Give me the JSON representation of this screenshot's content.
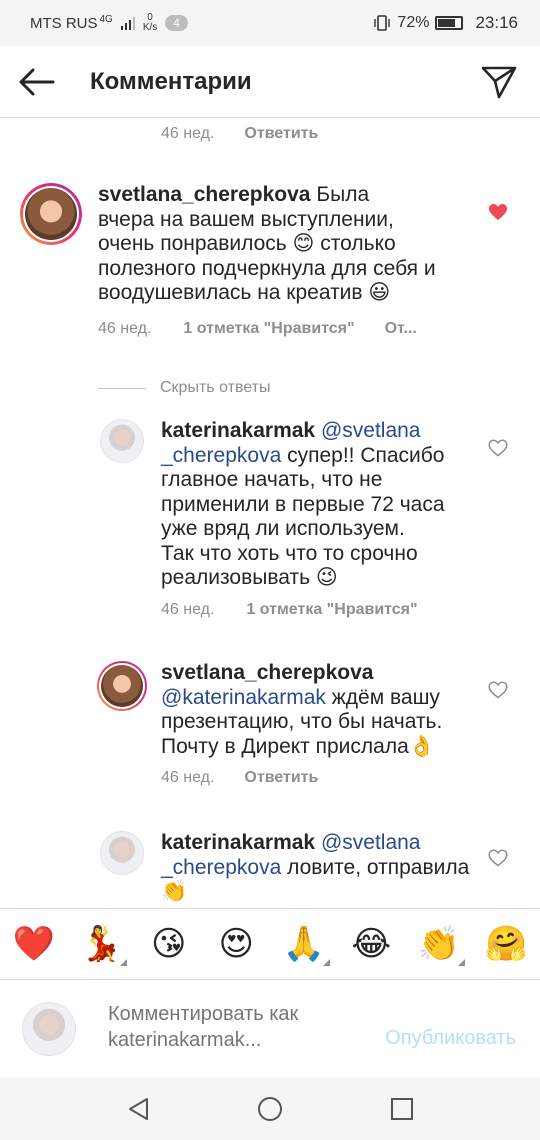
{
  "status_bar": {
    "carrier": "MTS RUS",
    "network": "4G",
    "speed_value": "0",
    "speed_unit": "K/s",
    "notification_count": "4",
    "battery_percent": "72%",
    "time": "23:16"
  },
  "header": {
    "title": "Комментарии",
    "back_icon": "arrow-left-icon",
    "send_icon": "paper-plane-icon"
  },
  "top_meta": {
    "time": "46 нед.",
    "reply_label": "Ответить"
  },
  "comments": [
    {
      "username": "svetlana_cherepkova",
      "lines": [
        "Была",
        "вчера на вашем выступлении,",
        "очень понравилось 😊 столько",
        "полезного подчеркнула для себя и",
        "воодушевилась на креатив 😃"
      ],
      "time": "46 нед.",
      "likes": "1 отметка \"Нравится\"",
      "reply_label": "От...",
      "liked": true
    },
    {
      "username": "katerinakarmak",
      "mention": "@svetlana",
      "lines": [
        "_cherepkova",
        "главное начать, что не",
        "применили в первые 72 часа",
        "уже вряд ли используем.",
        "Так что хоть что то срочно",
        "реализовывать 😉"
      ],
      "after_mention": "супер!! Спасибо",
      "time": "46 нед.",
      "likes": "1 отметка \"Нравится\"",
      "liked": false
    },
    {
      "username": "svetlana_cherepkova",
      "mention": "@katerinakarmak",
      "after_mention": "ждём вашу",
      "lines": [
        "презентацию, что бы начать.",
        "Почту в Директ прислала👌"
      ],
      "time": "46 нед.",
      "reply_label": "Ответить",
      "liked": false
    },
    {
      "username": "katerinakarmak",
      "mention": "@svetlana",
      "mention2": "_cherepkova",
      "after_mention": "ловите, отправила",
      "lines": [
        "👏"
      ],
      "liked": false
    }
  ],
  "hide_replies_label": "Скрыть ответы",
  "emoji_bar": [
    "❤️",
    "💃",
    "😘",
    "😍",
    "🙏",
    "😂",
    "👏",
    "🤗"
  ],
  "composer": {
    "placeholder": "Комментировать как katerinakarmak...",
    "publish_label": "Опубликовать"
  },
  "colors": {
    "accent_blue_disabled": "#b2dffc",
    "heart_red": "#ed4956",
    "mention_blue": "#2a4a8a"
  }
}
